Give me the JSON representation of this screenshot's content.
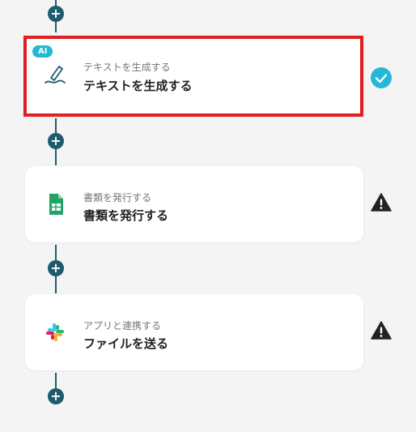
{
  "colors": {
    "accent": "#1f5b6e",
    "selected_border": "#e02020",
    "ai_badge": "#23b8d6",
    "check": "#23b8d6",
    "warning": "#222222"
  },
  "steps": [
    {
      "badge": "AI",
      "subtitle": "テキストを生成する",
      "title": "テキストを生成する",
      "icon": "pen-icon",
      "status": "check-icon"
    },
    {
      "subtitle": "書類を発行する",
      "title": "書類を発行する",
      "icon": "google-sheets-icon",
      "status": "warning-icon"
    },
    {
      "subtitle": "アプリと連携する",
      "title": "ファイルを送る",
      "icon": "slack-icon",
      "status": "warning-icon"
    }
  ],
  "add_button_label": "+"
}
